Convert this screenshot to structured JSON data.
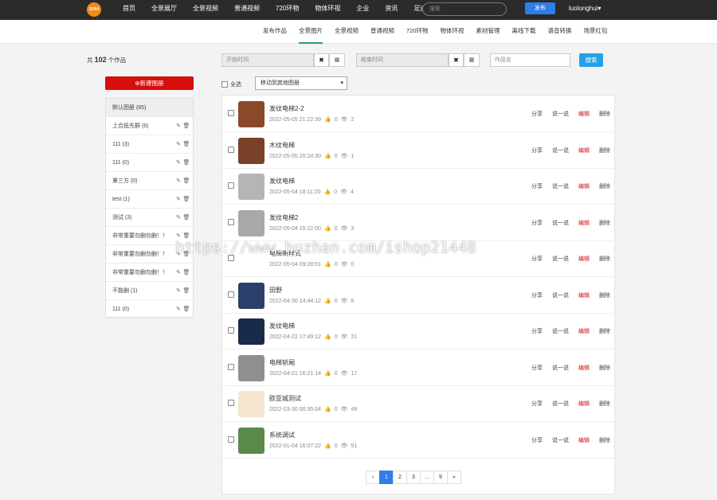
{
  "header": {
    "logo_text": "SP84",
    "nav": [
      "首页",
      "全景展厅",
      "全景视频",
      "普通视频",
      "720环物",
      "物体环视",
      "企业",
      "资讯",
      "足迹"
    ],
    "search_placeholder": "搜索",
    "publish_label": "发布",
    "username": "luolonghui",
    "user_caret": "▾"
  },
  "subnav": {
    "items": [
      "发布作品",
      "全景图片",
      "全景视频",
      "普通视频",
      "720环物",
      "物体环视",
      "素材管理",
      "离线下载",
      "语音转换",
      "场景红包"
    ],
    "active_index": 1
  },
  "summary": {
    "prefix": "共",
    "count": "102",
    "suffix": "个作品"
  },
  "sidebar": {
    "new_album_label": "⊕新建图册",
    "albums": [
      {
        "name": "默认图册 (85)"
      },
      {
        "name": "上合抵先群 (6)"
      },
      {
        "name": "111 (3)"
      },
      {
        "name": "111 (0)"
      },
      {
        "name": "第三方 (0)"
      },
      {
        "name": "test (1)"
      },
      {
        "name": "测试 (3)"
      },
      {
        "name": "非常重要勿删勿删！！"
      },
      {
        "name": "非常重要勿删勿删！！"
      },
      {
        "name": "非常重要勿删勿删！！"
      },
      {
        "name": "不能删 (1)"
      },
      {
        "name": "111 (0)"
      }
    ]
  },
  "filters": {
    "start_placeholder": "开始时间",
    "end_placeholder": "结束时间",
    "name_placeholder": "作品名",
    "clear_label": "✖",
    "calendar_label": "▦",
    "search_label": "搜索"
  },
  "toolbar": {
    "select_all_label": "全选",
    "move_label": "移动到其他图册",
    "move_caret": "▾"
  },
  "actions": {
    "share": "分享",
    "say": "说一说",
    "edit": "编辑",
    "delete": "删除"
  },
  "works": [
    {
      "title": "发纹电梯2-2",
      "date": "2022-05-05 21:22:39",
      "likes": "0",
      "views": "2",
      "thumb": "#8a4a2a"
    },
    {
      "title": "木纹电梯",
      "date": "2022-05-05 20:24:30",
      "likes": "0",
      "views": "1",
      "thumb": "#7a4128"
    },
    {
      "title": "发纹电梯",
      "date": "2022-05-04 18:11:20",
      "likes": "0",
      "views": "4",
      "thumb": "#b5b5b5"
    },
    {
      "title": "发纹电梯2",
      "date": "2022-05-04 15:22:00",
      "likes": "0",
      "views": "3",
      "thumb": "#a8a8a8"
    },
    {
      "title": "电梯新样式",
      "date": "2022-05-04 09:28:01",
      "likes": "0",
      "views": "0",
      "thumb": "#ffffff"
    },
    {
      "title": "田野",
      "date": "2022-04-30 14:44:12",
      "likes": "0",
      "views": "6",
      "thumb": "#2a3f6a"
    },
    {
      "title": "发纹电梯",
      "date": "2022-04-22 17:49:12",
      "likes": "0",
      "views": "21",
      "thumb": "#1a2a4a"
    },
    {
      "title": "电梯轿厢",
      "date": "2022-04-21 16:21:14",
      "likes": "0",
      "views": "17",
      "thumb": "#8f8f8f"
    },
    {
      "title": "欧亚城测试",
      "date": "2022-03-30 00:35:04",
      "likes": "0",
      "views": "49",
      "thumb": "#f5e6d0"
    },
    {
      "title": "系统调试",
      "date": "2022-01-04 16:07:22",
      "likes": "0",
      "views": "51",
      "thumb": "#5a8a4a"
    }
  ],
  "pager": {
    "prev": "‹",
    "pages": [
      "1",
      "2",
      "3",
      "…",
      "9"
    ],
    "next": "»",
    "active": "1"
  },
  "watermark": "https://www.huzhan.com/ishop21448"
}
